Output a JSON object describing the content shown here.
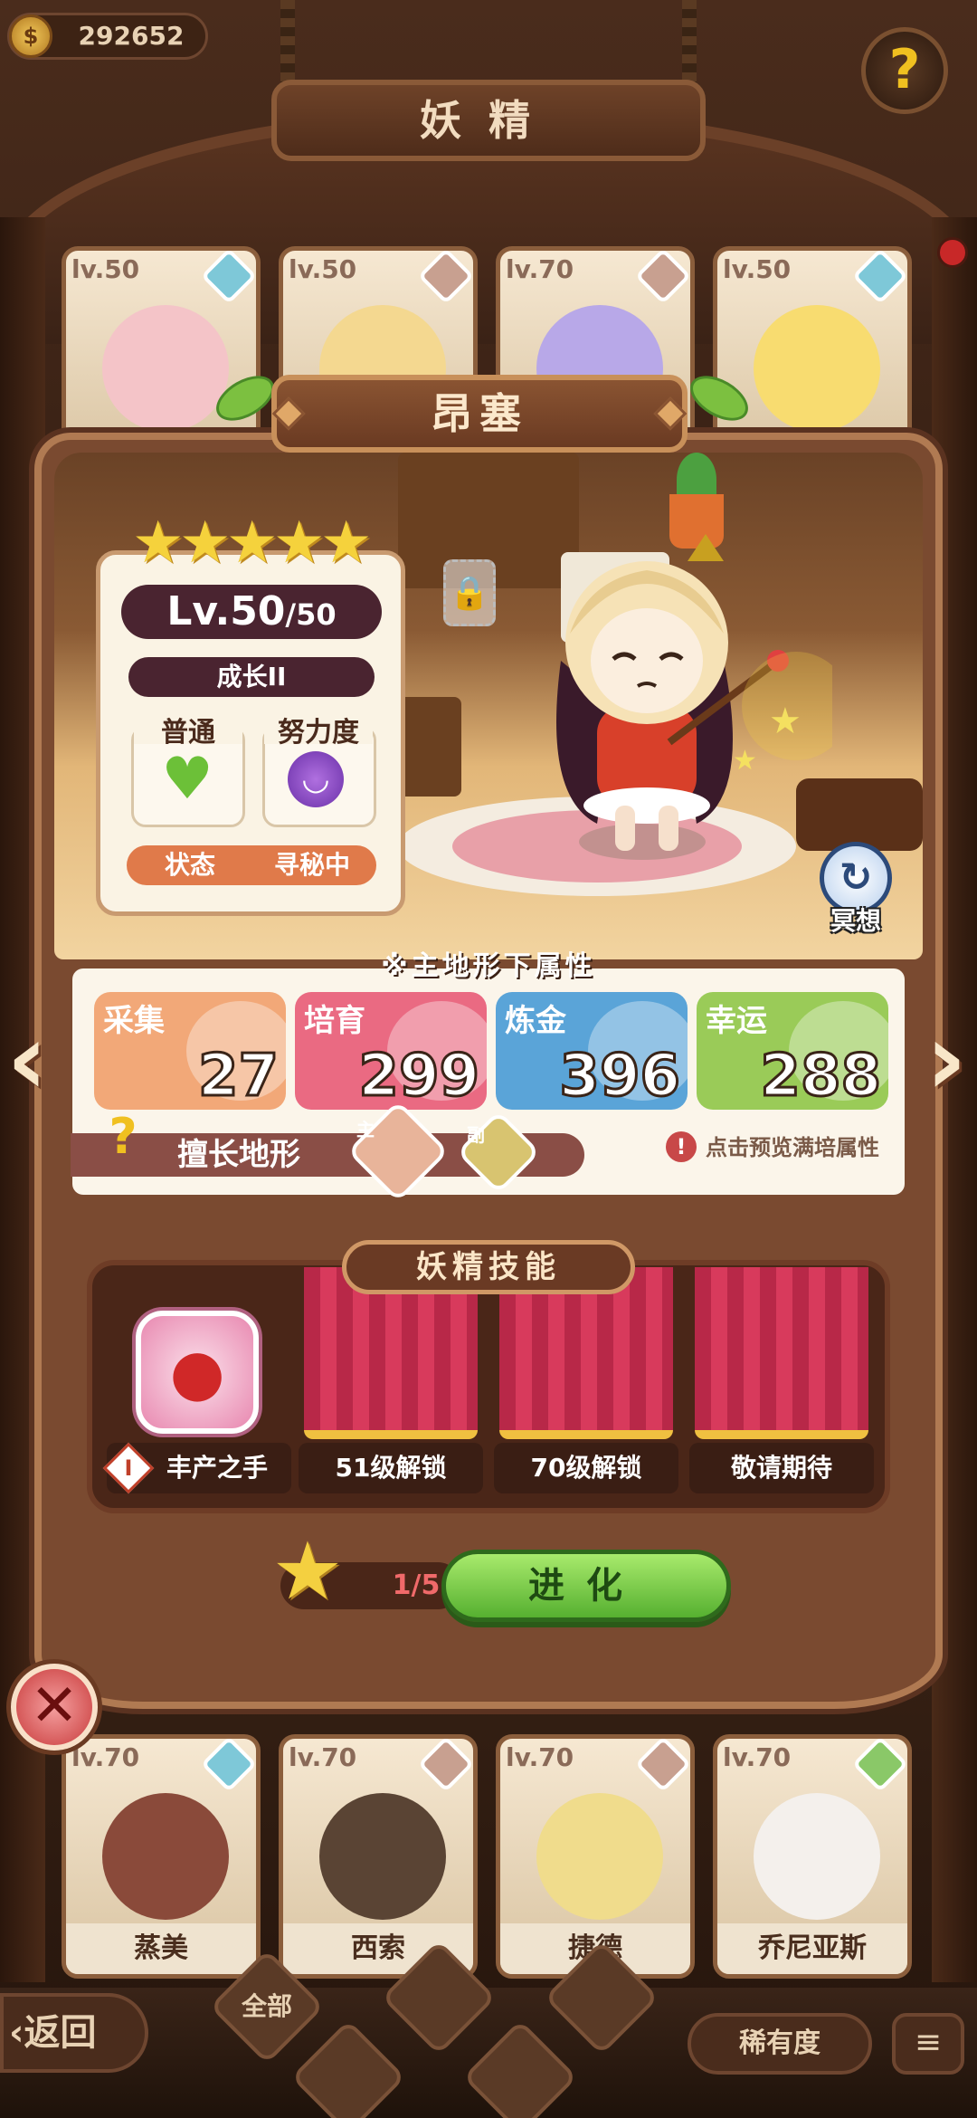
{
  "topbar": {
    "coin_value": "292652",
    "coin_icon": "coin-icon",
    "help_icon": "question-icon"
  },
  "page": {
    "title": "妖精"
  },
  "background_cards_top": [
    {
      "level": "lv.50",
      "element_color": "#7ec8d8",
      "face_color": "#f4c4c8"
    },
    {
      "level": "lv.50",
      "element_color": "#c8a090",
      "face_color": "#f4d890"
    },
    {
      "level": "lv.70",
      "element_color": "#c8a090",
      "face_color": "#b8a8e8"
    },
    {
      "level": "lv.50",
      "element_color": "#7ec8d8",
      "face_color": "#f8dc70"
    }
  ],
  "background_cards_bottom": [
    {
      "level": "lv.70",
      "name": "蒸美",
      "element_color": "#7ec8d8",
      "face_color": "#8a4a3a"
    },
    {
      "level": "lv.70",
      "name": "西索",
      "element_color": "#c8a090",
      "face_color": "#5a4434"
    },
    {
      "level": "lv.70",
      "name": "捷德",
      "element_color": "#c8a090",
      "face_color": "#f0dc8c"
    },
    {
      "level": "lv.70",
      "name": "乔尼亚斯",
      "element_color": "#8ac868",
      "face_color": "#f4f0ec"
    }
  ],
  "fairy": {
    "name": "昂塞",
    "stars": 5,
    "level": "Lv.50",
    "level_max": "/50",
    "growth": "成长II",
    "mood_label": "普通",
    "effort_label": "努力度",
    "status_label": "状态",
    "status_value": "寻秘中",
    "meditate_label": "冥想"
  },
  "attributes": {
    "heading": "※主地形下属性",
    "items": [
      {
        "label": "采集",
        "value": "27",
        "color": "#f2a878"
      },
      {
        "label": "培育",
        "value": "299",
        "color": "#ea6a82"
      },
      {
        "label": "炼金",
        "value": "396",
        "color": "#5aa4d8"
      },
      {
        "label": "幸运",
        "value": "288",
        "color": "#9acb58"
      }
    ],
    "terrain_label": "擅长地形",
    "terrain_main_tag": "主",
    "terrain_sub_tag": "副",
    "preview_text": "点击预览满培属性"
  },
  "skills": {
    "title": "妖精技能",
    "slots": [
      {
        "label": "丰产之手",
        "unlocked": true,
        "icon": "tomato-icon"
      },
      {
        "label": "51级解锁",
        "unlocked": false
      },
      {
        "label": "70级解锁",
        "unlocked": false
      },
      {
        "label": "敬请期待",
        "unlocked": false
      }
    ]
  },
  "evolve": {
    "progress": "1/5",
    "progress_fraction": 0.2,
    "button_label": "进化"
  },
  "bottom": {
    "back_label": "返回",
    "filter_all_label": "全部",
    "rarity_label": "稀有度",
    "sort_icon": "sort-icon"
  }
}
